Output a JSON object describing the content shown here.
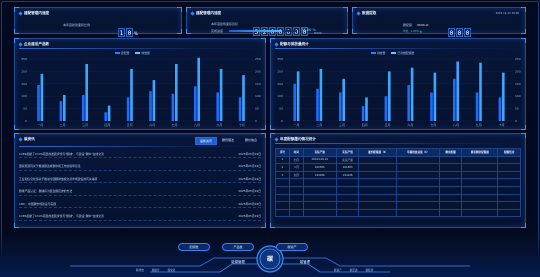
{
  "top_panels": {
    "p1": {
      "title": "建配管理内速度",
      "label": "本年度新建面积比例",
      "digits": [
        "1",
        "0"
      ],
      "unit": "%"
    },
    "p2": {
      "title": "建配管理内速度",
      "label": "本年度建筑面积目标",
      "digits": [
        "5",
        "2",
        "0",
        "0",
        "0",
        "0",
        "0"
      ],
      "unit": "tCO2",
      "progress_label": "完成进度",
      "progress_value": "77.66 %",
      "progress": 0.7766
    },
    "p3": {
      "title": "数据提取",
      "label": "碳配额",
      "value": "9000.xt",
      "digits": [
        "0",
        "0",
        "0"
      ],
      "sub": "单位：1.00% ▲",
      "timestamp": "2025-12-10 16:00"
    }
  },
  "chart_left": {
    "title": "企业建设产品数",
    "legend": [
      "建配量",
      "排放量"
    ],
    "chart_data": {
      "type": "bar",
      "categories": [
        "一月",
        "二月",
        "三月",
        "四月",
        "五月",
        "六月",
        "七月",
        "八月",
        "九月",
        "十月"
      ],
      "series": [
        {
          "name": "建配量",
          "values": [
            145,
            80,
            105,
            35,
            95,
            120,
            110,
            140,
            115,
            95
          ]
        },
        {
          "name": "排放量",
          "values": [
            190,
            105,
            230,
            62,
            210,
            165,
            230,
            255,
            210,
            185
          ]
        }
      ],
      "ylim": [
        0,
        250
      ],
      "yticks": [
        "0",
        "50",
        "100",
        "150",
        "200",
        "250"
      ],
      "colors": [
        "#2e7bff",
        "#2e7bff"
      ]
    }
  },
  "chart_right": {
    "title": "配额与排放量统计",
    "legend": [
      "排放量",
      "已清缴配额量"
    ],
    "chart_data": {
      "type": "bar",
      "categories": [
        "一月",
        "二月",
        "三月",
        "四月",
        "五月",
        "六月",
        "七月",
        "八月",
        "九月",
        "十月"
      ],
      "series": [
        {
          "name": "排放量",
          "values": [
            150,
            130,
            115,
            60,
            100,
            145,
            115,
            170,
            115,
            95
          ]
        },
        {
          "name": "已清缴配额量",
          "values": [
            200,
            210,
            170,
            95,
            200,
            215,
            195,
            240,
            235,
            195
          ]
        }
      ],
      "ylim": [
        0,
        250
      ],
      "yticks": [
        "0",
        "50",
        "100",
        "150",
        "200",
        "250"
      ],
      "colors": [
        "#2e7bff",
        "#2e7bff"
      ]
    }
  },
  "news": {
    "title": "碳资讯",
    "tabs": [
      "最新资讯",
      "碳管理法",
      "碳价信息"
    ],
    "items": [
      {
        "text": "CCER起航了CCUS项目的发展步伐与\"碳捕\"，与建设\"碳中\"在线交流",
        "date": "2025年05月19日"
      },
      {
        "text": "国家能源局关于推进碳达峰碳中和工作的指导意见",
        "date": "2025年05月19日"
      },
      {
        "text": "工业和信息化部关于推进全国碳排放权交易市场建设的有关事项",
        "date": "2025年05月19日"
      },
      {
        "text": "碳排产品认证：碳捕获为民生碳足迹的方法",
        "date": "2025年05月19日"
      },
      {
        "text": "CMC：中国碳市场建设与实践",
        "date": "2025年05月19日"
      },
      {
        "text": "CCER起航了CCUS项目的发展步伐与\"碳捕\"，与建设\"碳中\"在线交流",
        "date": "2025年05月19日"
      }
    ]
  },
  "table": {
    "title": "年度配额履约情况统计",
    "headers": [
      "序号",
      "时间",
      "实际产量",
      "实际产值",
      "履约配额量（t）",
      "年碳排放总量（t）",
      "剩余配额",
      "累积剩余配额量",
      "配额结余"
    ],
    "rows": [
      [
        "1",
        "七月",
        "28194.46.10",
        "实实产量",
        "",
        "",
        "",
        "",
        ""
      ],
      [
        "2",
        "八月",
        "162385",
        "161883",
        "",
        "",
        "",
        "",
        ""
      ],
      [
        "3",
        "九月",
        "194186",
        "194186",
        "",
        "",
        "",
        "",
        ""
      ]
    ]
  },
  "bottom": {
    "pills": [
      "配额数",
      "产品数",
      "碳资产"
    ],
    "left_label": "能源管理",
    "right_label": "碳管理",
    "logo": "碳",
    "side_items": [
      "碳排放",
      "碳统计",
      "碳交易",
      "碳资产",
      "碳足迹",
      "碳核查"
    ]
  }
}
